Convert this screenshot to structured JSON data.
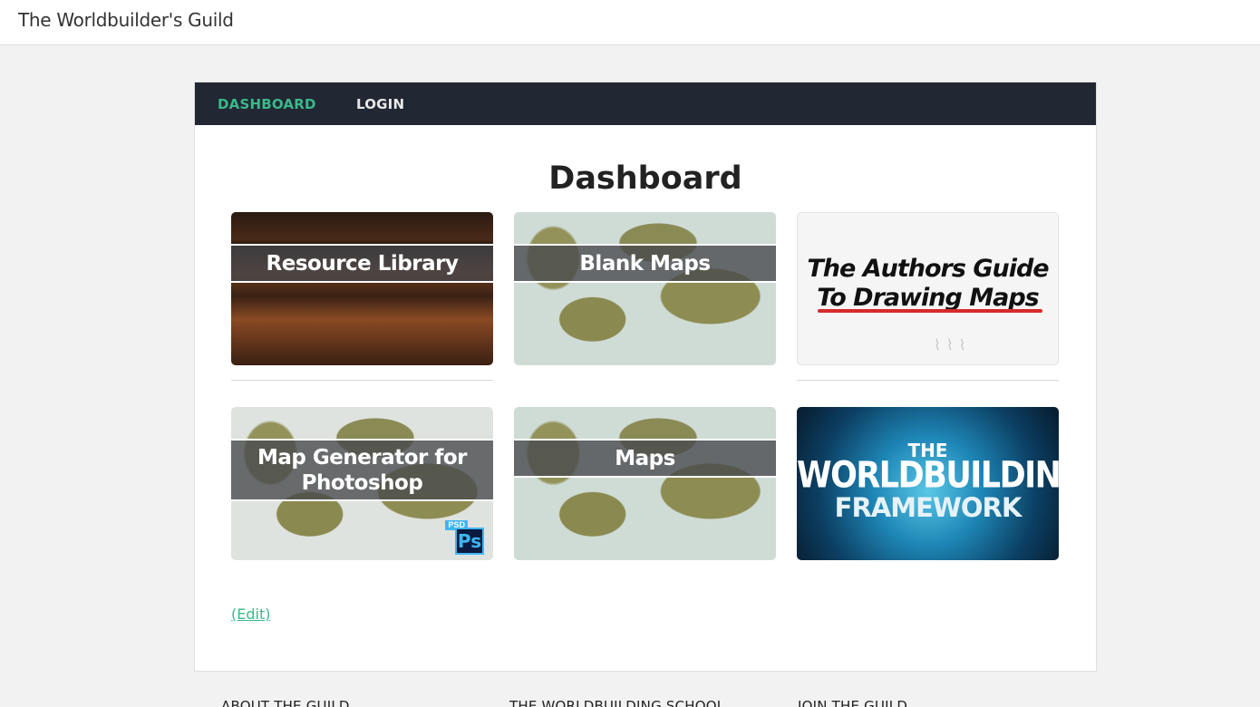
{
  "header": {
    "site_title": "The Worldbuilder's Guild"
  },
  "nav": {
    "items": [
      {
        "label": "DASHBOARD",
        "active": true
      },
      {
        "label": "LOGIN",
        "active": false
      }
    ]
  },
  "main": {
    "title": "Dashboard",
    "tiles": [
      {
        "label": "Resource Library"
      },
      {
        "label": "Blank Maps"
      },
      {
        "label": "The Authors Guide To Drawing Maps",
        "line1": "The Authors Guide",
        "line2": "To Drawing Maps",
        "style": "image-text"
      },
      {
        "label": "Map Generator for Photoshop",
        "line1": "Map Generator for",
        "line2": "Photoshop",
        "badge_tag": "PSD",
        "badge_text": "Ps"
      },
      {
        "label": "Maps"
      },
      {
        "label": "The Worldbuilding Framework",
        "line1": "THE",
        "line2": "WORLDBUILDING",
        "line3": "FRAMEWORK",
        "style": "image-text"
      }
    ],
    "edit_label": "(Edit)"
  },
  "footer": {
    "columns": [
      "ABOUT THE GUILD",
      "THE WORLDBUILDING SCHOOL",
      "JOIN THE GUILD"
    ]
  },
  "colors": {
    "accent": "#3cb88a",
    "nav_bg": "#212733",
    "highlight_red": "#d62b2b",
    "ps_blue": "#3eb6f5"
  },
  "icons": {
    "photoshop_badge": "photoshop-icon"
  }
}
